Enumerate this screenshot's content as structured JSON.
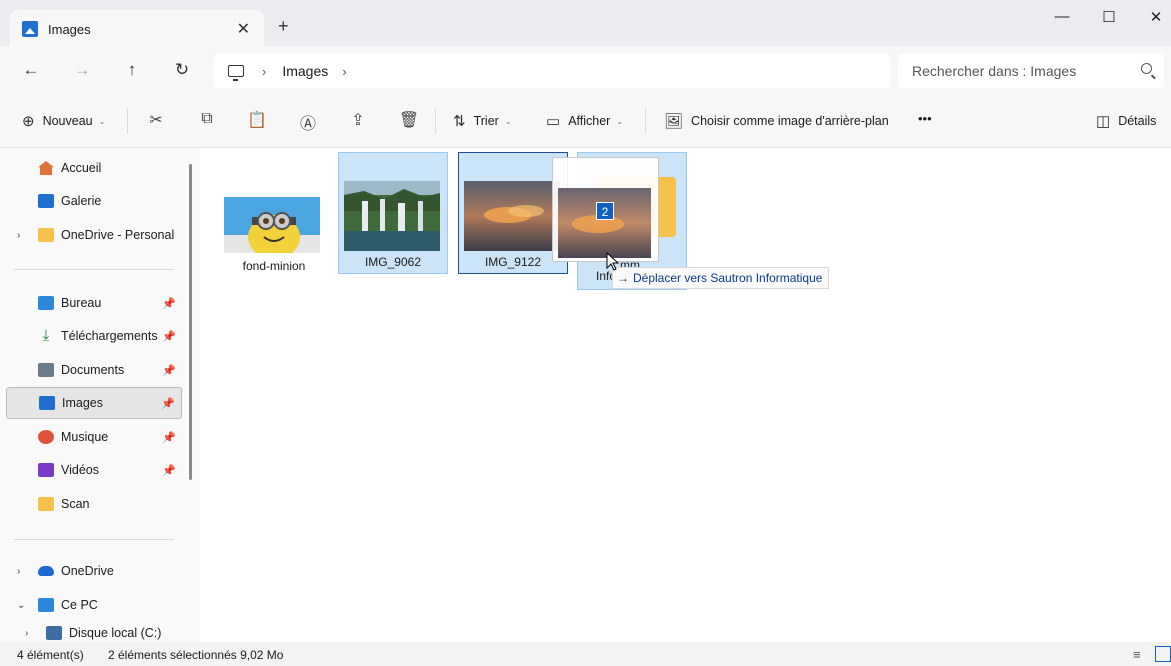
{
  "window": {
    "tab_title": "Images",
    "tab_close": "✕",
    "new_tab": "+",
    "minimize": "—",
    "maximize": "☐",
    "close": "✕"
  },
  "nav": {
    "back": "←",
    "forward": "→",
    "up": "↑",
    "refresh": "↻",
    "breadcrumb_sep": "›",
    "breadcrumb": [
      "Images"
    ],
    "search_placeholder": "Rechercher dans : Images"
  },
  "toolbar": {
    "new_label": "Nouveau",
    "sort_label": "Trier",
    "view_label": "Afficher",
    "wallpaper_label": "Choisir comme image d'arrière-plan",
    "more": "•••",
    "details_label": "Détails",
    "caret": "⌄"
  },
  "sidebar": {
    "items": [
      {
        "label": "Accueil",
        "icon": "home-icon",
        "color": "#e0733a"
      },
      {
        "label": "Galerie",
        "icon": "gallery-icon",
        "color": "#1f6fd0"
      },
      {
        "label": "OneDrive - Personal",
        "icon": "folder-icon",
        "color": "#f5c14b"
      },
      {
        "label": "Bureau",
        "icon": "desktop-icon",
        "color": "#2b88d8"
      },
      {
        "label": "Téléchargements",
        "icon": "download-icon",
        "color": "#1a7f37"
      },
      {
        "label": "Documents",
        "icon": "documents-icon",
        "color": "#6b7b8c"
      },
      {
        "label": "Images",
        "icon": "images-icon",
        "color": "#1f6fd0"
      },
      {
        "label": "Musique",
        "icon": "music-icon",
        "color": "#e0533a"
      },
      {
        "label": "Vidéos",
        "icon": "videos-icon",
        "color": "#7a3cc8"
      },
      {
        "label": "Scan",
        "icon": "folder-icon",
        "color": "#f5c14b"
      },
      {
        "label": "OneDrive",
        "icon": "cloud-icon",
        "color": "#1a6ad0"
      },
      {
        "label": "Ce PC",
        "icon": "pc-icon",
        "color": "#2b88d8"
      },
      {
        "label": "Disque local (C:)",
        "icon": "drive-icon",
        "color": "#3a6ea5"
      }
    ],
    "pin": "📌",
    "expand": "›",
    "expanded": "⌄"
  },
  "files": [
    {
      "name": "fond-minion",
      "selected": false
    },
    {
      "name": "IMG_9062",
      "selected": true
    },
    {
      "name": "IMG_9122",
      "selected": true
    },
    {
      "name": "Info",
      "selected": true
    }
  ],
  "drag": {
    "count": "2",
    "tooltip_arrow": "→",
    "tooltip": "Déplacer vers Sautron Informatique",
    "folder_partial": "mm"
  },
  "status": {
    "count": "4 élément(s)",
    "selection": "2 éléments sélectionnés  9,02 Mo"
  },
  "colors": {
    "selection_bg": "#cce4f7",
    "accent": "#1160c0"
  }
}
